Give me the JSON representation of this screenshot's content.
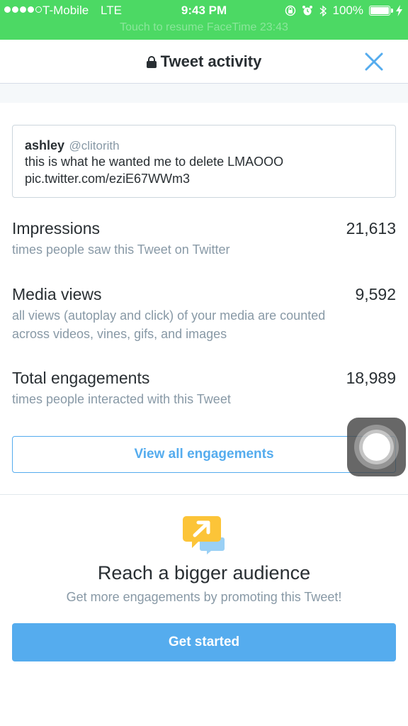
{
  "status_bar": {
    "carrier": "T-Mobile",
    "network": "LTE",
    "time": "9:43 PM",
    "battery": "100%",
    "facetime_banner": "Touch to resume FaceTime  23:43",
    "icons": [
      "signal-dots",
      "orientation-lock-icon",
      "alarm-icon",
      "bluetooth-icon",
      "battery-icon",
      "charging-icon"
    ]
  },
  "header": {
    "title": "Tweet activity",
    "icons": [
      "lock-icon",
      "close-icon"
    ]
  },
  "tweet": {
    "name": "ashley",
    "handle": "@clitorith",
    "text_line1": "this is what he wanted me to delete LMAOOO",
    "text_line2": "pic.twitter.com/eziE67WWm3"
  },
  "metrics": [
    {
      "label": "Impressions",
      "value": "21,613",
      "description": "times people saw this Tweet on Twitter"
    },
    {
      "label": "Media views",
      "value": "9,592",
      "description": "all views (autoplay and click) of your media are counted across videos, vines, gifs, and images"
    },
    {
      "label": "Total engagements",
      "value": "18,989",
      "description": "times people interacted with this Tweet"
    }
  ],
  "view_all_label": "View all engagements",
  "promote": {
    "icon": "promote-chat-icon",
    "title": "Reach a bigger audience",
    "subtitle": "Get more engagements by promoting this Tweet!",
    "button_label": "Get started"
  },
  "colors": {
    "status_bar": "#4cd964",
    "accent": "#55acee",
    "text": "#292f33",
    "muted": "#8899a6",
    "promote_yellow": "#fcc438",
    "promote_blue": "#9ad0f5"
  }
}
